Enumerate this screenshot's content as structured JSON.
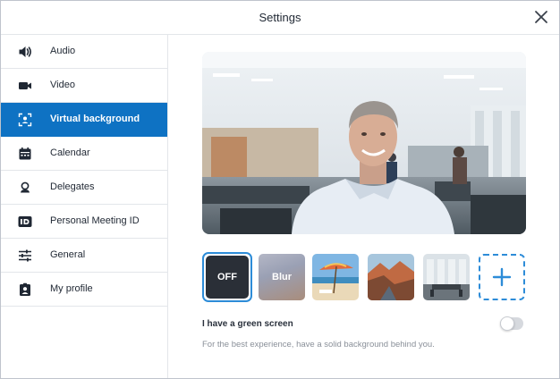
{
  "window": {
    "title": "Settings"
  },
  "sidebar": {
    "items": [
      {
        "label": "Audio",
        "icon": "speaker-icon"
      },
      {
        "label": "Video",
        "icon": "video-camera-icon"
      },
      {
        "label": "Virtual background",
        "icon": "virtual-background-icon",
        "active": true
      },
      {
        "label": "Calendar",
        "icon": "calendar-icon"
      },
      {
        "label": "Delegates",
        "icon": "delegate-icon"
      },
      {
        "label": "Personal Meeting ID",
        "icon": "id-badge-icon"
      },
      {
        "label": "General",
        "icon": "sliders-icon"
      },
      {
        "label": "My profile",
        "icon": "profile-badge-icon"
      }
    ]
  },
  "backgrounds": {
    "off_label": "OFF",
    "blur_label": "Blur",
    "selected": "OFF",
    "options": [
      "OFF",
      "Blur",
      "beach",
      "canyon",
      "office"
    ]
  },
  "green_screen": {
    "label": "I have a green screen",
    "enabled": false,
    "hint": "For the best experience, have a solid background behind you."
  },
  "colors": {
    "accent": "#0e72c3",
    "selection_border": "#2d8cd8"
  }
}
